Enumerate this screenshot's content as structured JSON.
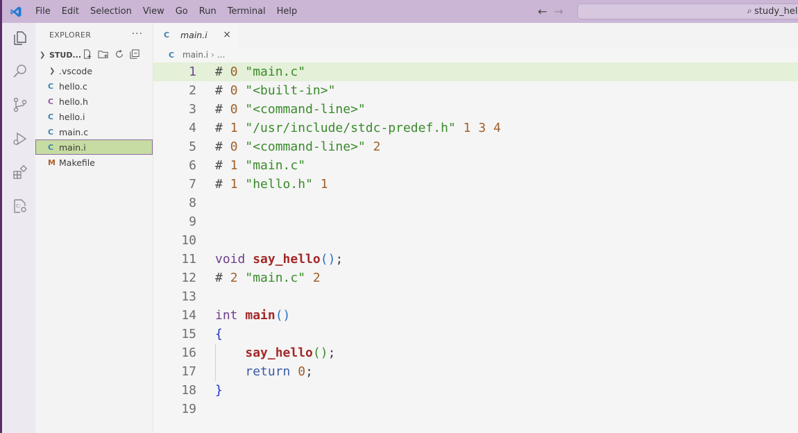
{
  "menu": [
    "File",
    "Edit",
    "Selection",
    "View",
    "Go",
    "Run",
    "Terminal",
    "Help"
  ],
  "search": {
    "label": "study_hello"
  },
  "sidebar": {
    "title": "EXPLORER",
    "more": "···",
    "folder": "STUD...",
    "items": [
      {
        "label": ".vscode",
        "type": "folder",
        "icon": ""
      },
      {
        "label": "hello.c",
        "type": "c",
        "icon": "C"
      },
      {
        "label": "hello.h",
        "type": "h",
        "icon": "C"
      },
      {
        "label": "hello.i",
        "type": "i",
        "icon": "C"
      },
      {
        "label": "main.c",
        "type": "c",
        "icon": "C"
      },
      {
        "label": "main.i",
        "type": "i",
        "icon": "C",
        "selected": true
      },
      {
        "label": "Makefile",
        "type": "make",
        "icon": "M"
      }
    ]
  },
  "editor": {
    "tab": {
      "label": "main.i",
      "icon": "C",
      "close": "×"
    },
    "breadcrumb": {
      "file": "main.i",
      "rest": "..."
    },
    "lines": [
      {
        "n": "1",
        "tokens": [
          [
            "pp",
            "# "
          ],
          [
            "num",
            "0"
          ],
          [
            "punc",
            " "
          ],
          [
            "str",
            "\"main.c\""
          ]
        ]
      },
      {
        "n": "2",
        "tokens": [
          [
            "pp",
            "# "
          ],
          [
            "num",
            "0"
          ],
          [
            "punc",
            " "
          ],
          [
            "str",
            "\"<built-in>\""
          ]
        ]
      },
      {
        "n": "3",
        "tokens": [
          [
            "pp",
            "# "
          ],
          [
            "num",
            "0"
          ],
          [
            "punc",
            " "
          ],
          [
            "str",
            "\"<command-line>\""
          ]
        ]
      },
      {
        "n": "4",
        "tokens": [
          [
            "pp",
            "# "
          ],
          [
            "num",
            "1"
          ],
          [
            "punc",
            " "
          ],
          [
            "str",
            "\"/usr/include/stdc-predef.h\""
          ],
          [
            "punc",
            " "
          ],
          [
            "num",
            "1 3 4"
          ]
        ]
      },
      {
        "n": "5",
        "tokens": [
          [
            "pp",
            "# "
          ],
          [
            "num",
            "0"
          ],
          [
            "punc",
            " "
          ],
          [
            "str",
            "\"<command-line>\""
          ],
          [
            "punc",
            " "
          ],
          [
            "num",
            "2"
          ]
        ]
      },
      {
        "n": "6",
        "tokens": [
          [
            "pp",
            "# "
          ],
          [
            "num",
            "1"
          ],
          [
            "punc",
            " "
          ],
          [
            "str",
            "\"main.c\""
          ]
        ]
      },
      {
        "n": "7",
        "tokens": [
          [
            "pp",
            "# "
          ],
          [
            "num",
            "1"
          ],
          [
            "punc",
            " "
          ],
          [
            "str",
            "\"hello.h\""
          ],
          [
            "punc",
            " "
          ],
          [
            "num",
            "1"
          ]
        ]
      },
      {
        "n": "8",
        "tokens": []
      },
      {
        "n": "9",
        "tokens": []
      },
      {
        "n": "10",
        "tokens": []
      },
      {
        "n": "11",
        "tokens": [
          [
            "kw",
            "void"
          ],
          [
            "punc",
            " "
          ],
          [
            "fn",
            "say_hello"
          ],
          [
            "pn",
            "()"
          ],
          [
            "punc",
            ";"
          ]
        ]
      },
      {
        "n": "12",
        "tokens": [
          [
            "pp",
            "# "
          ],
          [
            "num",
            "2"
          ],
          [
            "punc",
            " "
          ],
          [
            "str",
            "\"main.c\""
          ],
          [
            "punc",
            " "
          ],
          [
            "num",
            "2"
          ]
        ]
      },
      {
        "n": "13",
        "tokens": []
      },
      {
        "n": "14",
        "tokens": [
          [
            "kw",
            "int"
          ],
          [
            "punc",
            " "
          ],
          [
            "fn",
            "main"
          ],
          [
            "pn",
            "()"
          ]
        ]
      },
      {
        "n": "15",
        "tokens": [
          [
            "brace",
            "{"
          ]
        ]
      },
      {
        "n": "16",
        "tokens": [
          [
            "punc",
            "    "
          ],
          [
            "fn",
            "say_hello"
          ],
          [
            "paren-g",
            "()"
          ],
          [
            "punc",
            ";"
          ]
        ],
        "guide": true
      },
      {
        "n": "17",
        "tokens": [
          [
            "punc",
            "    "
          ],
          [
            "kw2",
            "return"
          ],
          [
            "punc",
            " "
          ],
          [
            "num",
            "0"
          ],
          [
            "punc",
            ";"
          ]
        ],
        "guide": true
      },
      {
        "n": "18",
        "tokens": [
          [
            "brace",
            "}"
          ]
        ]
      },
      {
        "n": "19",
        "tokens": []
      }
    ],
    "current_line": "1"
  },
  "colors": {
    "titlebar": "#cbb6d6",
    "accent": "#5a2d6b",
    "selected_file": "#c7dca2",
    "current_line": "#e4f0d8"
  }
}
